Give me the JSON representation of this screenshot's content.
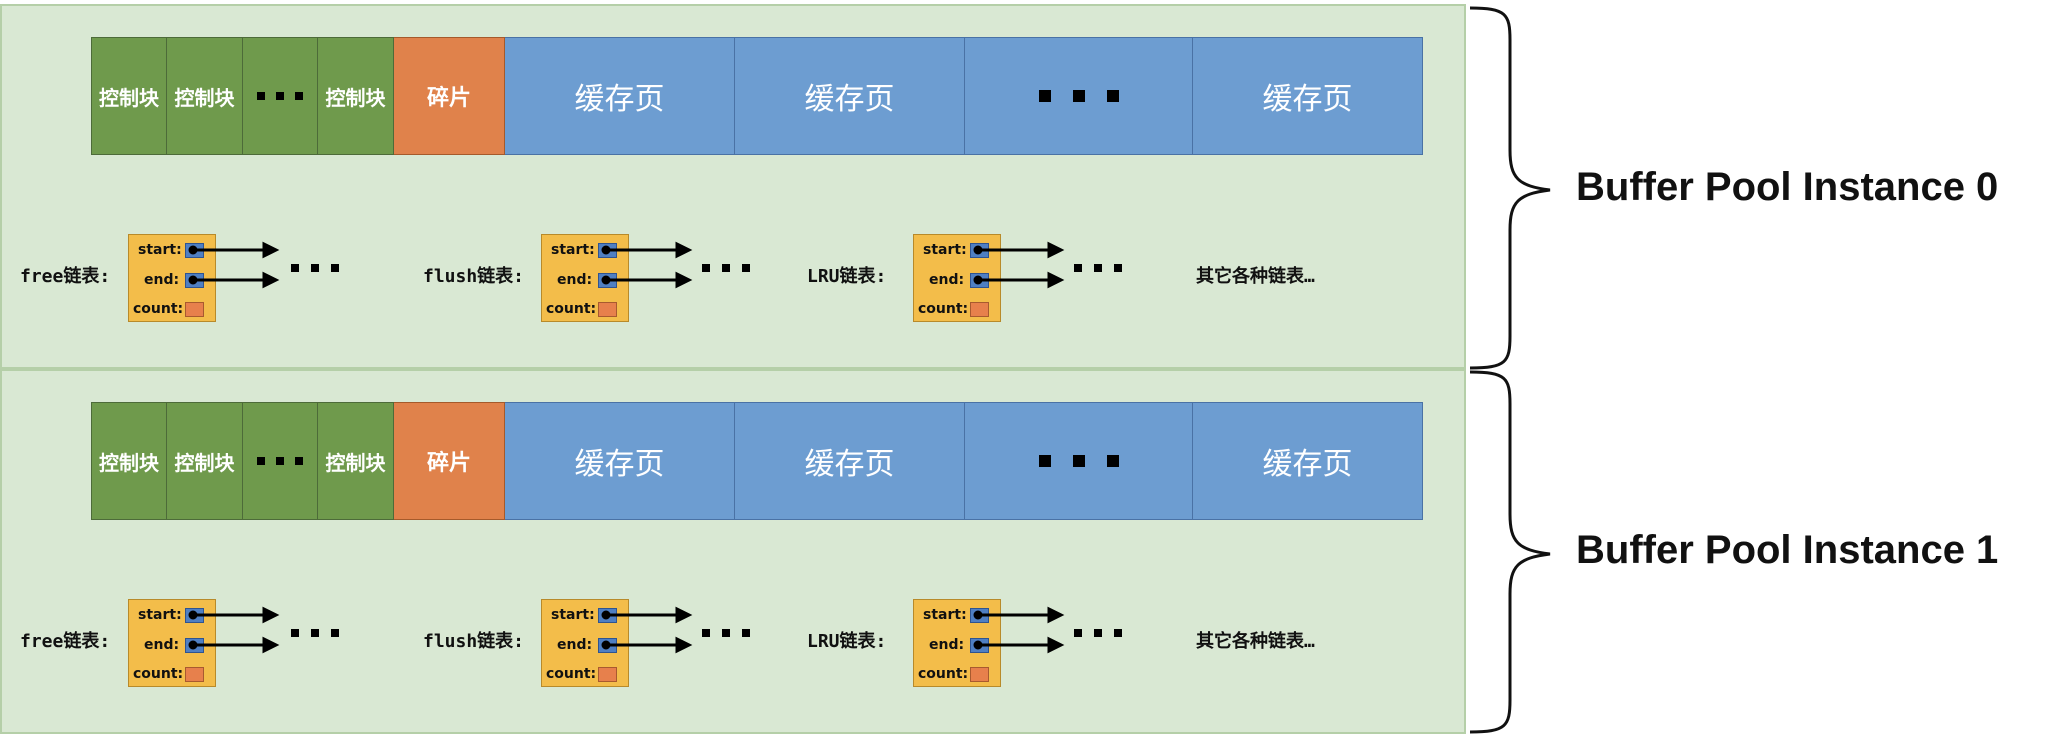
{
  "instances": [
    {
      "label": "Buffer Pool Instance 0"
    },
    {
      "label": "Buffer Pool Instance 1"
    }
  ],
  "blocks": {
    "control": "控制块",
    "fragment": "碎片",
    "cache_page": "缓存页"
  },
  "lists": {
    "free": "free链表:",
    "flush": "flush链表:",
    "lru": "LRU链表:",
    "others": "其它各种链表…"
  },
  "list_fields": {
    "start": "start:",
    "end": "end:",
    "count": "count:"
  },
  "colors": {
    "instance_bg": "#d9e8d3",
    "control_block": "#6f9a4c",
    "fragment": "#e0824b",
    "cache_page": "#6d9dd1",
    "list_box": "#f3bd4a"
  }
}
